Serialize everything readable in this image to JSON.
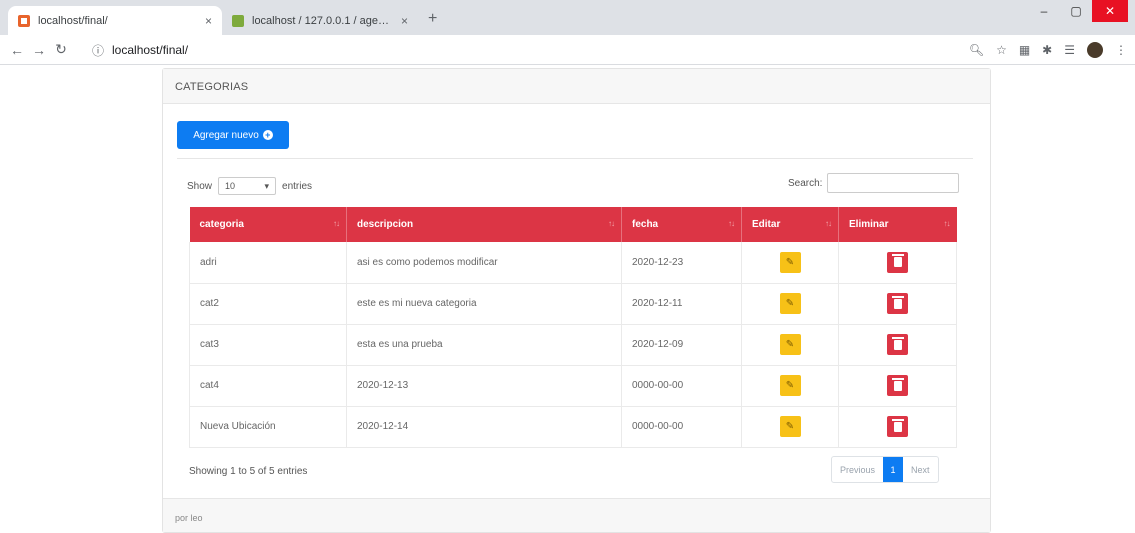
{
  "browser": {
    "tabs": [
      {
        "title": "localhost/final/",
        "close": "×"
      },
      {
        "title": "localhost / 127.0.0.1 / agenda / c",
        "close": "×"
      }
    ],
    "new_tab": "+",
    "url": "localhost/final/",
    "window_controls": {
      "minimize": "–",
      "maximize": "▢",
      "close": "✕"
    }
  },
  "card": {
    "header": "CATEGORIAS",
    "add_button": "Agregar nuevo",
    "footer": "por leo"
  },
  "table_controls": {
    "show_label": "Show",
    "page_length": "10",
    "entries_label": "entries",
    "search_label": "Search:",
    "search_value": ""
  },
  "table": {
    "columns": [
      "categoria",
      "descripcion",
      "fecha",
      "Editar",
      "Eliminar"
    ],
    "rows": [
      {
        "categoria": "adri",
        "descripcion": "asi es como podemos modificar",
        "fecha": "2020-12-23"
      },
      {
        "categoria": "cat2",
        "descripcion": "este es mi nueva categoria",
        "fecha": "2020-12-11"
      },
      {
        "categoria": "cat3",
        "descripcion": "esta es una prueba",
        "fecha": "2020-12-09"
      },
      {
        "categoria": "cat4",
        "descripcion": "2020-12-13",
        "fecha": "0000-00-00"
      },
      {
        "categoria": "Nueva Ubicación",
        "descripcion": "2020-12-14",
        "fecha": "0000-00-00"
      }
    ]
  },
  "pagination": {
    "info": "Showing 1 to 5 of 5 entries",
    "previous": "Previous",
    "current": "1",
    "next": "Next"
  },
  "colors": {
    "header_red": "#dc3545",
    "primary_blue": "#0d7cf2",
    "edit_yellow": "#f7c117"
  }
}
